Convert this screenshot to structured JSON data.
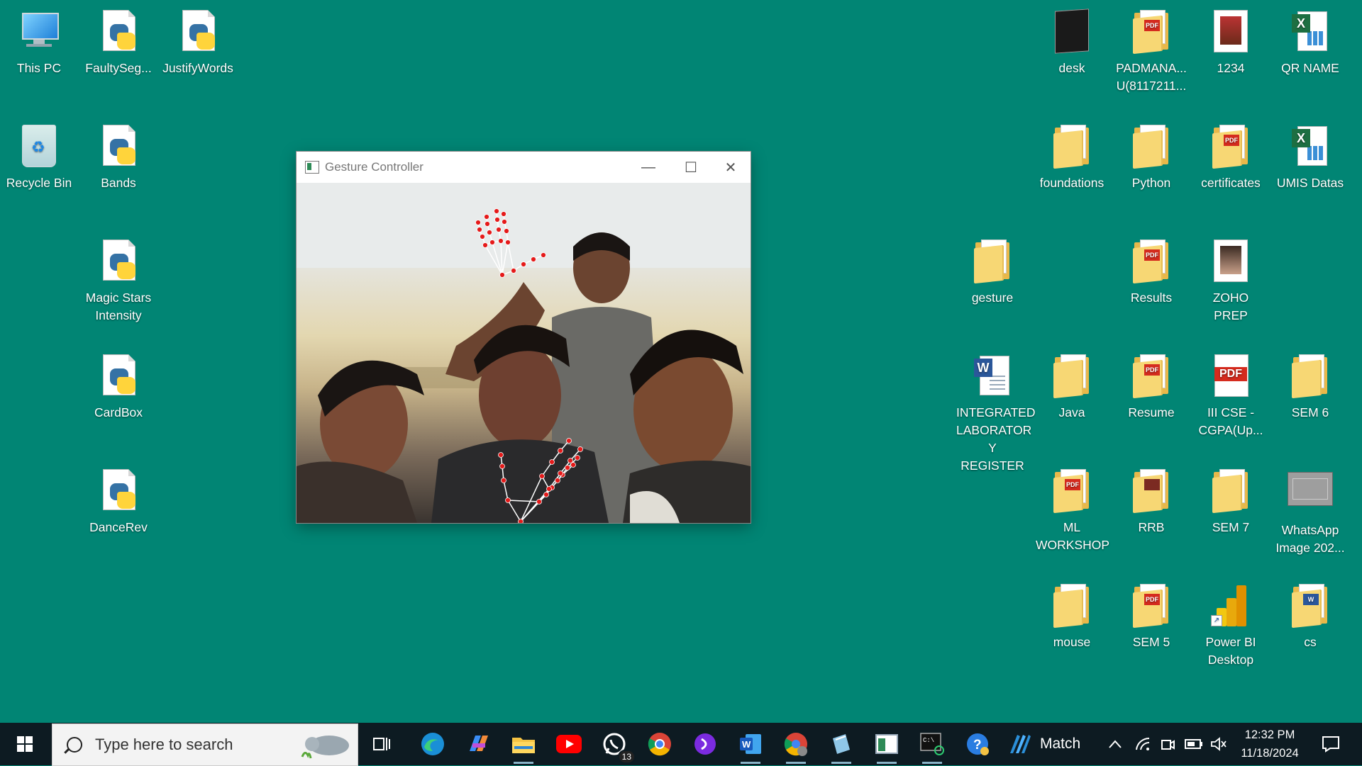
{
  "desktop": {
    "left_icons": [
      {
        "label": "This PC",
        "kind": "pc"
      },
      {
        "label": "FaultySeg...",
        "kind": "python"
      },
      {
        "label": "JustifyWords",
        "kind": "python"
      },
      {
        "label": "Recycle Bin",
        "kind": "bin"
      },
      {
        "label": "Bands",
        "kind": "python"
      },
      {
        "label": "Magic Stars Intensity",
        "kind": "python"
      },
      {
        "label": "CardBox",
        "kind": "python"
      },
      {
        "label": "DanceRev",
        "kind": "python"
      }
    ],
    "right_icons": [
      {
        "label": "desk",
        "kind": "desk-file"
      },
      {
        "label": "PADMANA... U(8117211...",
        "kind": "folder-pdf"
      },
      {
        "label": "1234",
        "kind": "photo"
      },
      {
        "label": "QR NAME",
        "kind": "excel"
      },
      {
        "label": "foundations",
        "kind": "folder"
      },
      {
        "label": "Python",
        "kind": "folder"
      },
      {
        "label": "certificates",
        "kind": "folder-pdf"
      },
      {
        "label": "UMIS Datas",
        "kind": "excel"
      },
      {
        "label": "gesture",
        "kind": "folder"
      },
      {
        "label": "Results",
        "kind": "folder-pdf"
      },
      {
        "label": "ZOHO PREP",
        "kind": "photo"
      },
      {
        "label": "INTEGRATED LABORATOR Y REGISTER",
        "kind": "word"
      },
      {
        "label": "Java",
        "kind": "folder"
      },
      {
        "label": "Resume",
        "kind": "folder-pdf"
      },
      {
        "label": "III CSE - CGPA(Up...",
        "kind": "pdf"
      },
      {
        "label": "SEM 6",
        "kind": "folder"
      },
      {
        "label": "ML WORKSHOP",
        "kind": "folder-pdf"
      },
      {
        "label": "RRB",
        "kind": "photo"
      },
      {
        "label": "SEM 7",
        "kind": "folder"
      },
      {
        "label": "WhatsApp Image 202...",
        "kind": "image"
      },
      {
        "label": "mouse",
        "kind": "folder"
      },
      {
        "label": "SEM 5",
        "kind": "folder-pdf"
      },
      {
        "label": "Power BI Desktop",
        "kind": "powerbi"
      },
      {
        "label": "cs",
        "kind": "folder-word"
      }
    ]
  },
  "window": {
    "title": "Gesture Controller",
    "minimize": "—",
    "maximize": "☐",
    "close": "✕"
  },
  "taskbar": {
    "search_placeholder": "Type here to search",
    "whatsapp_badge": "13",
    "match_label": "Match",
    "time": "12:32 PM",
    "date": "11/18/2024",
    "icons": [
      "task-view-icon",
      "edge-icon",
      "copilot-icon",
      "file-explorer-icon",
      "youtube-icon",
      "whatsapp-icon",
      "chrome-icon",
      "arc-icon",
      "word-icon",
      "chrome-alt-icon",
      "notepad-icon",
      "window-app-icon",
      "terminal-icon",
      "help-icon"
    ]
  },
  "colors": {
    "desktop_bg": "#018574",
    "taskbar_bg": "#0d1b22",
    "landmark": "#e51a1a"
  }
}
